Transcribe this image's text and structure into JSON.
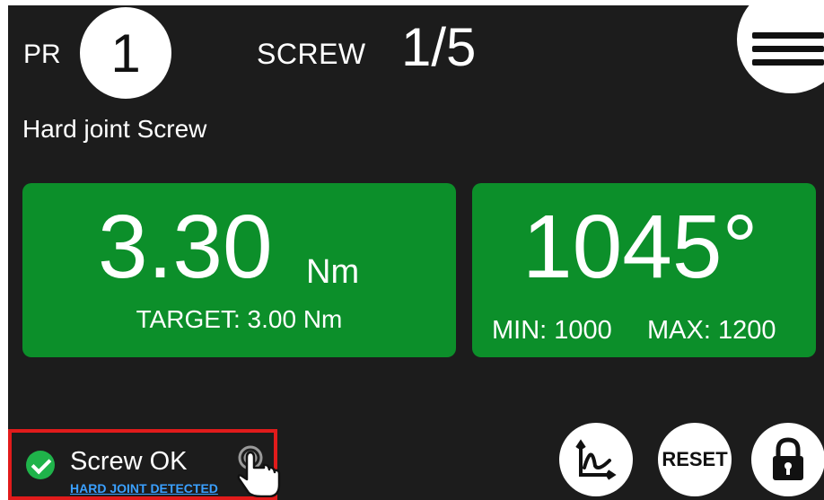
{
  "header": {
    "pr_label": "PR",
    "pr_number": "1",
    "screw_label": "SCREW",
    "screw_count": "1/5",
    "menu_icon": "hamburger-menu-icon"
  },
  "program_name": "Hard joint Screw",
  "torque": {
    "value": "3.30",
    "unit": "Nm",
    "target": "TARGET: 3.00 Nm"
  },
  "angle": {
    "value": "1045°",
    "min": "MIN: 1000",
    "max": "MAX: 1200"
  },
  "status": {
    "icon": "check-circle-icon",
    "text": "Screw OK",
    "detail": "HARD JOINT DETECTED",
    "tap_icon": "tap-hand-icon"
  },
  "actions": {
    "chart_icon": "chart-icon",
    "reset_label": "RESET",
    "lock_icon": "lock-icon"
  },
  "colors": {
    "background": "#1c1c1c",
    "panel_green": "#0c8f2a",
    "status_check": "#1fb34a",
    "highlight_border": "#e11b1b",
    "link_blue": "#3aa0ff"
  }
}
